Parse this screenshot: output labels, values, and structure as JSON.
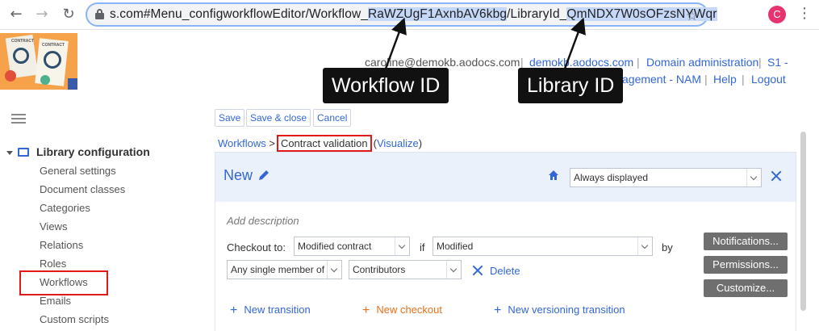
{
  "browser": {
    "url_parts": [
      {
        "text": "s.com#Menu_configworkflowEditor/Workflow_",
        "highlight": false
      },
      {
        "text": "RaWZUgF1AxnbAV6kbg",
        "highlight": true
      },
      {
        "text": "/LibraryId_",
        "highlight": false
      },
      {
        "text": "QmNDX7W0sOFzsNYWqr",
        "highlight": true
      }
    ],
    "profile_initial": "C"
  },
  "header": {
    "user_email": "caroline@demokb.aodocs.com",
    "domain_link": "demokb.aodocs.com",
    "domain_admin": "Domain administration",
    "s1": "S1 -",
    "management": "agement - NAM",
    "help": "Help",
    "logout": "Logout",
    "logo_text_1": "CONTRACT",
    "logo_text_2": "CONTRACT"
  },
  "callouts": {
    "workflow_id": "Workflow ID",
    "library_id": "Library ID"
  },
  "sidebar": {
    "section_title": "Library configuration",
    "items": [
      "General settings",
      "Document classes",
      "Categories",
      "Views",
      "Relations",
      "Roles",
      "Workflows",
      "Emails",
      "Custom scripts"
    ],
    "selected": "Workflows"
  },
  "toolbar": {
    "save": "Save",
    "save_close": "Save & close",
    "cancel": "Cancel"
  },
  "breadcrumb": {
    "root": "Workflows",
    "separator": ">",
    "current": "Contract validation",
    "visualize_open": "(",
    "visualize": "Visualize",
    "visualize_close": ")"
  },
  "state": {
    "title": "New",
    "display_select": "Always displayed",
    "add_description": "Add description",
    "checkout_label": "Checkout to:",
    "checkout_select": "Modified contract",
    "if_label": "if",
    "condition_select": "Modified",
    "by_label": "by",
    "member_select": "Any single member of",
    "role_select": "Contributors",
    "delete": "Delete",
    "notifications": "Notifications...",
    "permissions": "Permissions...",
    "customize": "Customize...",
    "new_transition": "New transition",
    "new_checkout": "New checkout",
    "new_versioning_transition": "New versioning transition"
  },
  "colors": {
    "link": "#3367d6",
    "highlight": "#e0191b",
    "orange": "#e8711a"
  }
}
